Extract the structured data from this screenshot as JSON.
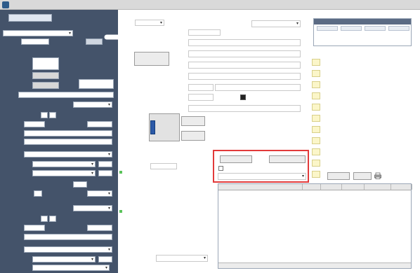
{
  "window": {
    "title": ""
  },
  "left": {
    "header_date": "",
    "header_code": "",
    "dat_combo": "",
    "password_label": "",
    "password_value": "",
    "section1_title": "",
    "type_label": "",
    "client_label": "",
    "immat_label": "",
    "nom_label": "",
    "provenance_title": "",
    "provenance_date": "",
    "heure_label": "",
    "escale_label": "",
    "vol_label": "",
    "aeroport_label": "",
    "mvt_label": "",
    "balisage_label": "",
    "balisage_value": "",
    "regles_label": "",
    "regles_value": "",
    "passagers_label": "",
    "passenger_count": "",
    "passerelle_label": "",
    "destination_title": "",
    "destination_date": "",
    "dest_heure_hh": "",
    "dest_heure_mm": "",
    "dest_balisage_value": "",
    "dest_regles_value": ""
  },
  "center": {
    "site_label": "",
    "site_value": "",
    "recherche_label": "",
    "recherche_value": "",
    "fact_complementaire": "",
    "break_label": "",
    "sans_tpf1": "",
    "sans_tpf2": "",
    "etablissement_label": "",
    "calculer_btn": "",
    "promotion_btn": "",
    "no_stationnement": "",
    "payment_combo": "",
    "historique_btn": "",
    "apercu_btn": "",
    "facturer_btn": "",
    "sunrise_text": "",
    "sunset_text": "",
    "parking_label": ""
  },
  "services": [
    {
      "label": ""
    },
    {
      "label": ""
    },
    {
      "label": ""
    },
    {
      "label": ""
    },
    {
      "label": ""
    },
    {
      "label": ""
    },
    {
      "label": ""
    },
    {
      "label": ""
    },
    {
      "label": ""
    },
    {
      "label": ""
    },
    {
      "label": ""
    }
  ],
  "summary": {
    "title": "",
    "columns": [
      "",
      "",
      "",
      ""
    ]
  },
  "grid": {
    "columns": [
      "",
      "",
      "",
      "",
      "",
      ""
    ]
  }
}
